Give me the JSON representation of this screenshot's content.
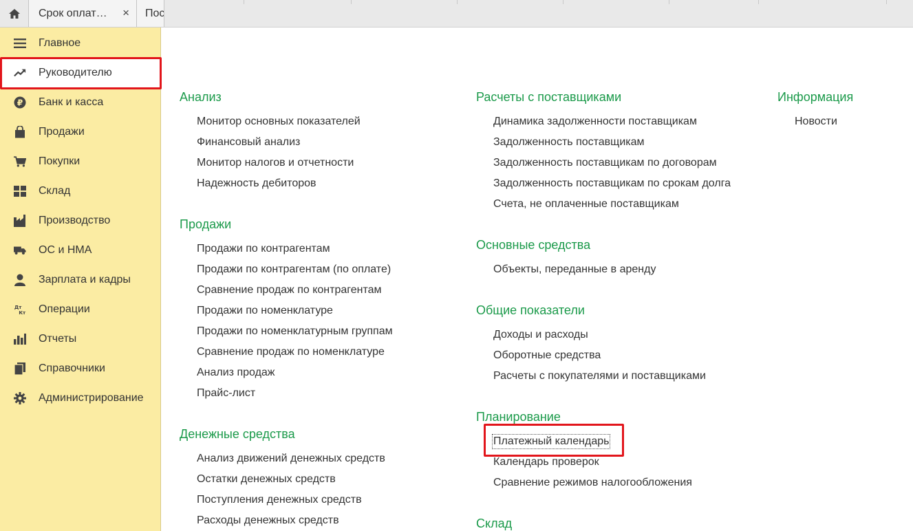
{
  "tabs": {
    "home_icon": "home-icon",
    "tab1_label": "Срок оплат…",
    "tab1_close": "×",
    "tab2_label": "Пос"
  },
  "sidebar": {
    "items": [
      {
        "label": "Главное",
        "icon": "menu-icon"
      },
      {
        "label": "Руководителю",
        "icon": "trend-icon"
      },
      {
        "label": "Банк и касса",
        "icon": "ruble-icon"
      },
      {
        "label": "Продажи",
        "icon": "bag-icon"
      },
      {
        "label": "Покупки",
        "icon": "cart-icon"
      },
      {
        "label": "Склад",
        "icon": "warehouse-icon"
      },
      {
        "label": "Производство",
        "icon": "factory-icon"
      },
      {
        "label": "ОС и НМА",
        "icon": "truck-icon"
      },
      {
        "label": "Зарплата и кадры",
        "icon": "person-icon"
      },
      {
        "label": "Операции",
        "icon": "dt-kt-icon"
      },
      {
        "label": "Отчеты",
        "icon": "bar-chart-icon"
      },
      {
        "label": "Справочники",
        "icon": "books-icon"
      },
      {
        "label": "Администрирование",
        "icon": "gear-icon"
      }
    ],
    "active_index": 1
  },
  "content": {
    "col1": [
      {
        "title": "Анализ",
        "links": [
          "Монитор основных показателей",
          "Финансовый анализ",
          "Монитор налогов и отчетности",
          "Надежность дебиторов"
        ]
      },
      {
        "title": "Продажи",
        "links": [
          "Продажи по контрагентам",
          "Продажи по контрагентам (по оплате)",
          "Сравнение продаж по контрагентам",
          "Продажи по номенклатуре",
          "Продажи по номенклатурным группам",
          "Сравнение продаж по номенклатуре",
          "Анализ продаж",
          "Прайс-лист"
        ]
      },
      {
        "title": "Денежные средства",
        "links": [
          "Анализ движений денежных средств",
          "Остатки денежных средств",
          "Поступления денежных средств",
          "Расходы денежных средств"
        ]
      }
    ],
    "col2": [
      {
        "title": "Расчеты с поставщиками",
        "links": [
          "Динамика задолженности поставщикам",
          "Задолженность поставщикам",
          "Задолженность поставщикам по договорам",
          "Задолженность поставщикам по срокам долга",
          "Счета, не оплаченные поставщикам"
        ]
      },
      {
        "title": "Основные средства",
        "links": [
          "Объекты, переданные в аренду"
        ]
      },
      {
        "title": "Общие показатели",
        "links": [
          "Доходы и расходы",
          "Оборотные средства",
          "Расчеты с покупателями и поставщиками"
        ]
      },
      {
        "title": "Планирование",
        "links": [
          "Платежный календарь",
          "Календарь проверок",
          "Сравнение режимов налогообложения"
        ]
      },
      {
        "title": "Склад",
        "links": []
      }
    ],
    "col3": [
      {
        "title": "Информация",
        "links": [
          "Новости"
        ]
      }
    ]
  },
  "colors": {
    "sidebar_bg": "#fbeca3",
    "section_title": "#1b9a4a",
    "highlight": "#e2151b"
  }
}
